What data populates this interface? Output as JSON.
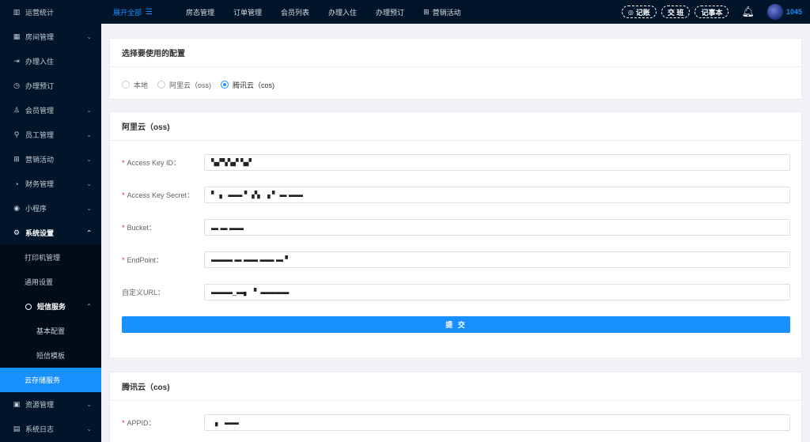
{
  "sidebar": {
    "items": [
      {
        "label": "运营统计",
        "icon": "bar-chart-icon"
      },
      {
        "label": "房间管理",
        "icon": "grid-icon"
      },
      {
        "label": "办理入住",
        "icon": "checkin-icon"
      },
      {
        "label": "办理预订",
        "icon": "clock-icon"
      },
      {
        "label": "会员管理",
        "icon": "user-icon"
      },
      {
        "label": "员工管理",
        "icon": "staff-icon"
      },
      {
        "label": "营销活动",
        "icon": "sitemap-icon"
      },
      {
        "label": "财务管理",
        "icon": "finance-icon"
      },
      {
        "label": "小程序",
        "icon": "wechat-icon"
      },
      {
        "label": "系统设置",
        "icon": "gear-icon"
      }
    ],
    "system_sub": [
      "打印机管理",
      "通用设置"
    ],
    "sms": {
      "label": "短信服务",
      "children": [
        "基本配置",
        "短信模板"
      ]
    },
    "active": "云存储服务",
    "bottom": [
      {
        "label": "资源管理",
        "icon": "image-icon"
      },
      {
        "label": "系统日志",
        "icon": "calendar-icon"
      }
    ]
  },
  "header": {
    "expand_label": "展开全部",
    "nav": [
      {
        "label": "房态管理"
      },
      {
        "label": "订单管理"
      },
      {
        "label": "会员列表"
      },
      {
        "label": "办理入住"
      },
      {
        "label": "办理预订"
      },
      {
        "label": "营销活动"
      }
    ],
    "pills": [
      "记账",
      "交 班",
      "记事本"
    ],
    "user_id": "1045"
  },
  "config_card": {
    "title": "选择要使用的配置",
    "options": [
      "本地",
      "阿里云（oss)",
      "腾讯云（cos)"
    ],
    "selected": "腾讯云（cos)"
  },
  "oss_card": {
    "title": "阿里云（oss)",
    "fields": [
      {
        "label": "Access Key ID",
        "required": true,
        "value": "▚▞▚▚▞ ▚▞"
      },
      {
        "label": "Access Key Secret",
        "required": true,
        "value": "▘▗   ▬▬ ▘ ▞▖ ▗ ▘ ▬ ▬▬"
      },
      {
        "label": "Bucket",
        "required": true,
        "value": "▬ ▬ ▬▬"
      },
      {
        "label": "EndPoint",
        "required": true,
        "value": "▬▬▬ ▬ ▬▬ ▬▬ ▬ ▘"
      },
      {
        "label": "自定义URL",
        "required": false,
        "value": "▬▬▬_▬▖ ▝  ▬▬▬▬"
      }
    ],
    "submit_label": "提 交"
  },
  "cos_card": {
    "title": "腾讯云（cos)",
    "fields": [
      {
        "label": "APPID",
        "required": true,
        "value": "  ▖  ▬▬"
      }
    ]
  }
}
